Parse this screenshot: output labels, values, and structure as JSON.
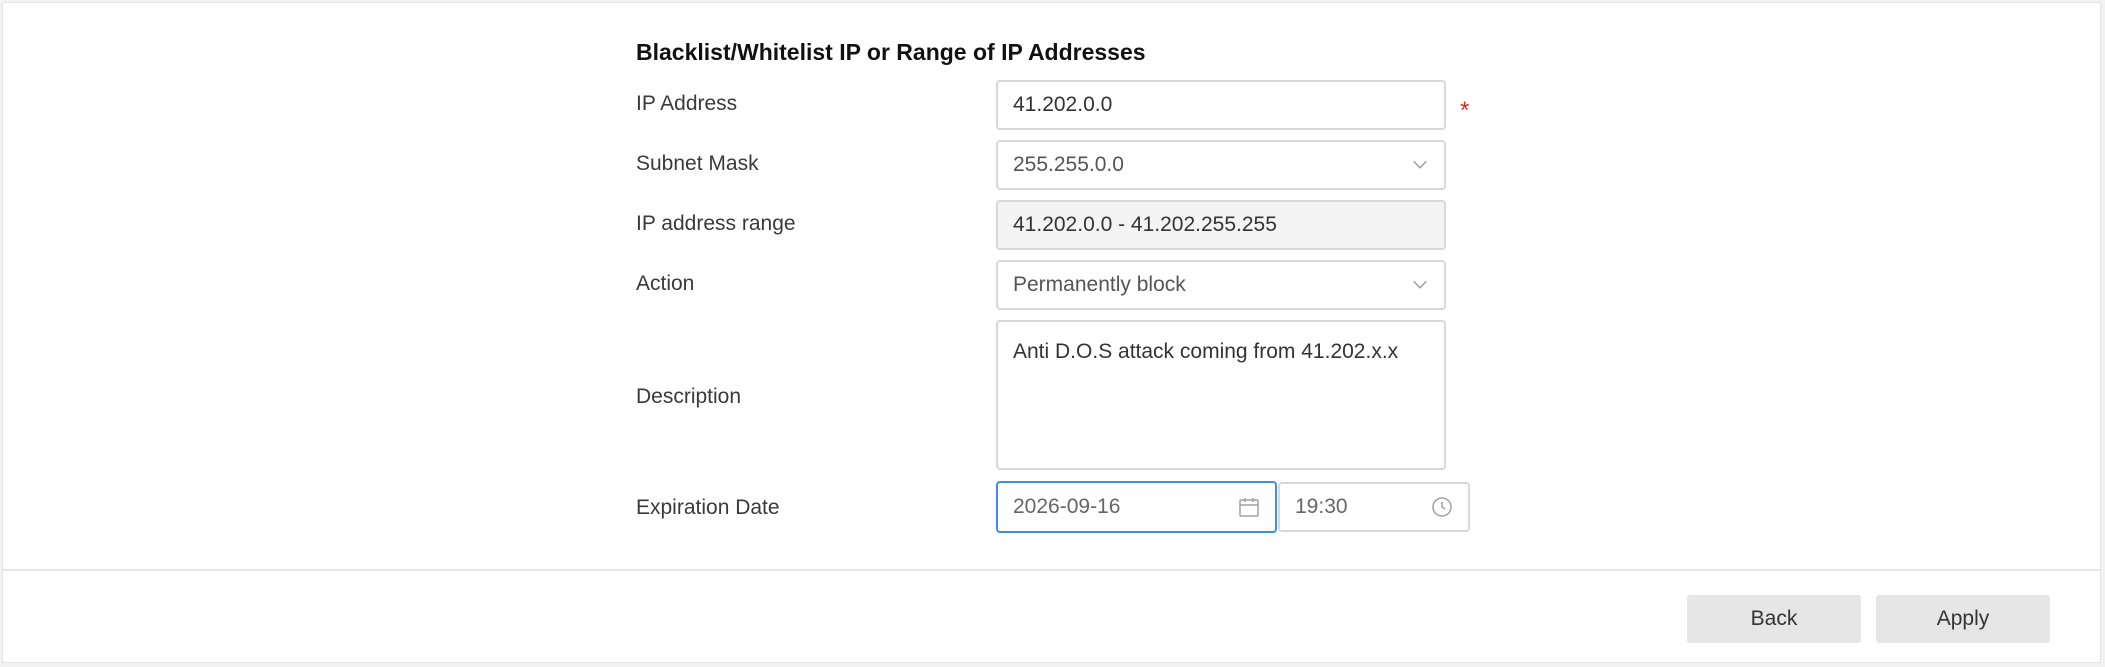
{
  "form": {
    "title": "Blacklist/Whitelist IP or Range of IP Addresses",
    "required_marker": "*",
    "ip_address": {
      "label": "IP Address",
      "value": "41.202.0.0"
    },
    "subnet_mask": {
      "label": "Subnet Mask",
      "value": "255.255.0.0"
    },
    "ip_range": {
      "label": "IP address range",
      "value": "41.202.0.0 - 41.202.255.255"
    },
    "action": {
      "label": "Action",
      "value": "Permanently block"
    },
    "description": {
      "label": "Description",
      "value": "Anti D.O.S attack coming from 41.202.x.x"
    },
    "expiration": {
      "label": "Expiration Date",
      "date": "2026-09-16",
      "time": "19:30"
    }
  },
  "footer": {
    "back_label": "Back",
    "apply_label": "Apply"
  },
  "icons": {
    "dropdown": "chevron-down-icon",
    "date": "calendar-icon",
    "time": "clock-icon"
  },
  "colors": {
    "required": "#e0281c",
    "focus_border": "#3d8ee8"
  }
}
